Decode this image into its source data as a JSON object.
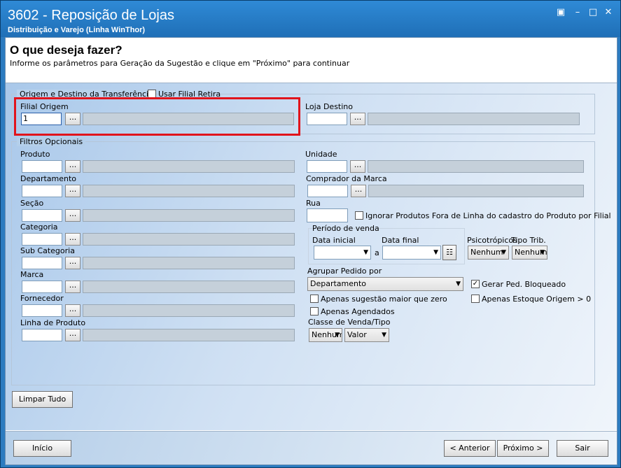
{
  "window": {
    "title": "3602 - Reposição de Lojas",
    "subtitle": "Distribuição e Varejo (Linha WinThor)"
  },
  "header": {
    "title": "O que deseja fazer?",
    "instruction": "Informe os parâmetros para Geração da Sugestão e clique em \"Próximo\" para continuar"
  },
  "transfer_group": {
    "label": "Origem e Destino da Transferência",
    "usar_filial_retira": "Usar Filial Retira",
    "filial_origem_label": "Filial Origem",
    "filial_origem_value": "1",
    "loja_destino_label": "Loja Destino",
    "lookup_button": "..."
  },
  "filters_group": {
    "label": "Filtros Opcionais",
    "produto": "Produto",
    "departamento": "Departamento",
    "secao": "Seção",
    "categoria": "Categoria",
    "sub_categoria": "Sub Categoria",
    "marca": "Marca",
    "fornecedor": "Fornecedor",
    "linha_produto": "Linha de Produto",
    "unidade": "Unidade",
    "comprador_marca": "Comprador da Marca",
    "rua": "Rua",
    "ignorar_fora_linha": "Ignorar Produtos Fora de Linha do cadastro do Produto por Filial",
    "periodo_venda": "Período de venda",
    "data_inicial": "Data inicial",
    "data_final": "Data final",
    "data_sep": "a",
    "psicotropicos": "Psicotrópicos",
    "psicotropicos_value": "Nenhum",
    "tipo_trib": "Tipo Trib.",
    "tipo_trib_value": "Nenhum",
    "agrupar_pedido": "Agrupar Pedido por",
    "agrupar_pedido_value": "Departamento",
    "gerar_ped_bloqueado": "Gerar Ped. Bloqueado",
    "apenas_sugestao": "Apenas sugestão maior que zero",
    "apenas_estoque": "Apenas Estoque Origem > 0",
    "apenas_agendados": "Apenas Agendados",
    "classe_venda": "Classe de Venda/Tipo",
    "classe_value": "Nenhum",
    "tipo_value": "Valor"
  },
  "buttons": {
    "limpar_tudo": "Limpar Tudo",
    "inicio": "Início",
    "anterior": "< Anterior",
    "proximo": "Próximo >",
    "sair": "Sair"
  }
}
